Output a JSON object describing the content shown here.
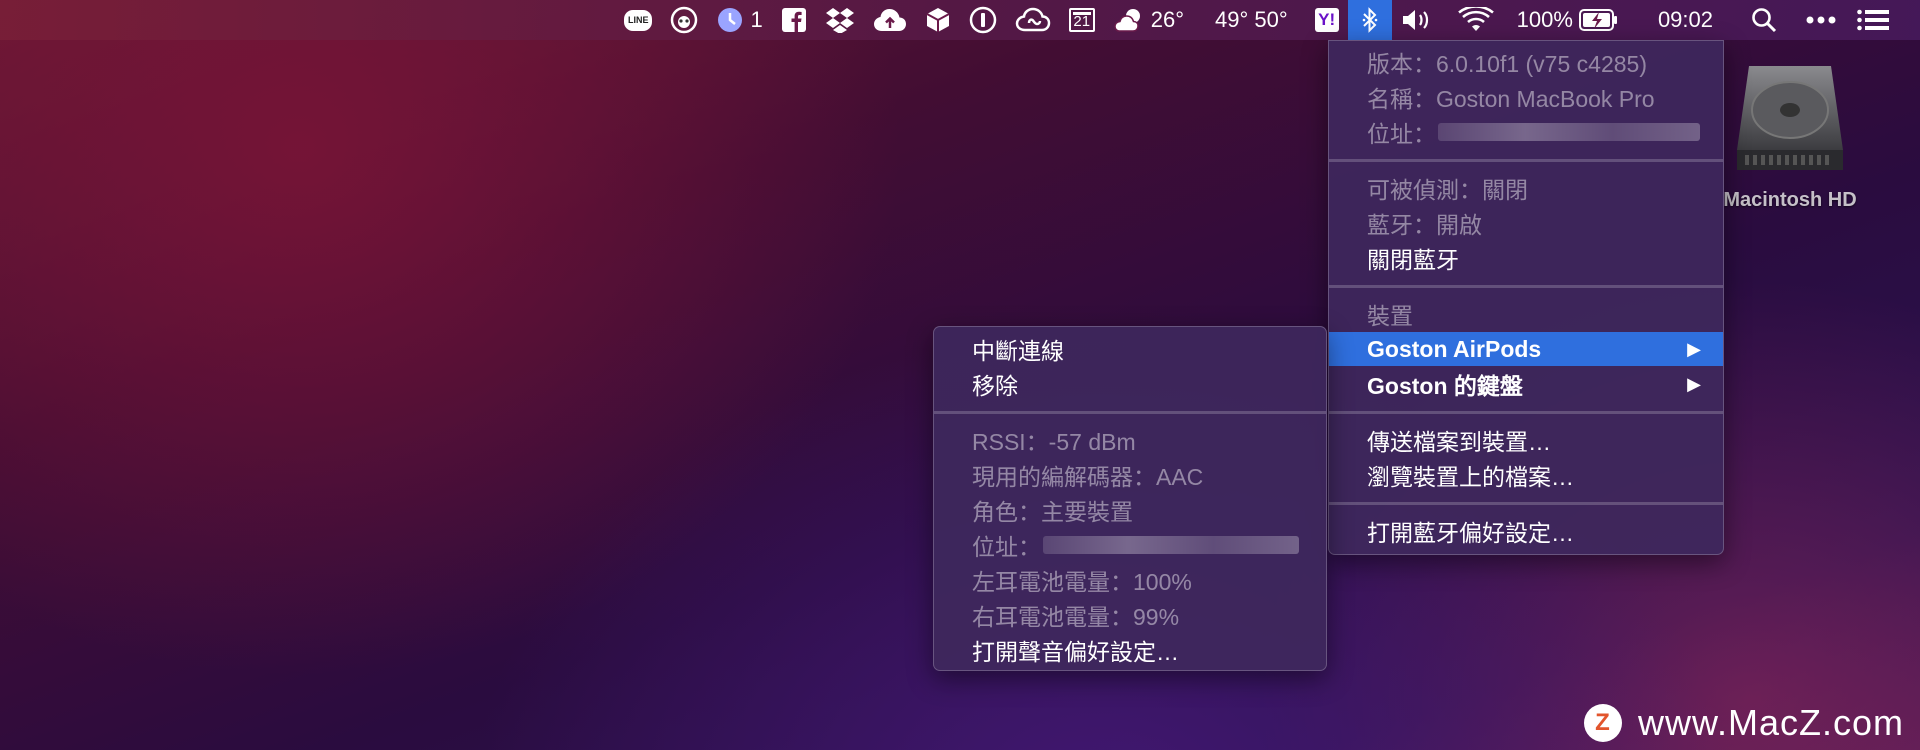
{
  "menubar": {
    "line_label": "LINE",
    "clock_count": "1",
    "calendar_day": "21",
    "weather_temp": "26°",
    "temps": "49° 50°",
    "yahoo_label": "Y!",
    "battery_percent": "100%",
    "time": "09:02",
    "icons": [
      "line-icon",
      "panda-icon",
      "clock-icon",
      "facebook-icon",
      "dropbox-icon",
      "cloud-upload-icon",
      "box-icon",
      "1password-icon",
      "creative-cloud-icon",
      "calendar-icon",
      "weather-icon",
      "yahoo-icon",
      "bluetooth-icon",
      "volume-icon",
      "wifi-icon",
      "battery-icon",
      "spotlight-icon",
      "more-icon",
      "notification-center-icon"
    ]
  },
  "bluetooth_menu": {
    "version": "版本：6.0.10f1 (v75 c4285)",
    "name": "名稱：Goston MacBook Pro",
    "address_label": "位址：",
    "discoverable": "可被偵測：關閉",
    "bluetooth_state": "藍牙：開啟",
    "turn_off": "關閉藍牙",
    "devices_header": "裝置",
    "device_airpods": "Goston AirPods",
    "device_keyboard": "Goston 的鍵盤",
    "send_file": "傳送檔案到裝置…",
    "browse_files": "瀏覽裝置上的檔案…",
    "open_prefs": "打開藍牙偏好設定…",
    "submenu_arrow": "▶"
  },
  "airpods_submenu": {
    "disconnect": "中斷連線",
    "remove": "移除",
    "rssi": "RSSI：-57 dBm",
    "codec": "現用的編解碼器：AAC",
    "role": "角色：主要裝置",
    "address_label": "位址：",
    "left_battery": "左耳電池電量：100%",
    "right_battery": "右耳電池電量：99%",
    "sound_prefs": "打開聲音偏好設定…"
  },
  "desktop": {
    "hd_label": "Macintosh HD",
    "watermark_logo": "Z",
    "watermark_text": "www.MacZ.com"
  }
}
